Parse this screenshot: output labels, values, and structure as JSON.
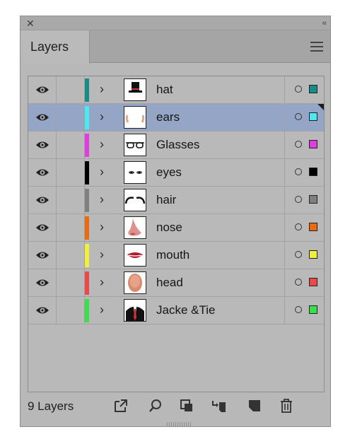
{
  "window": {
    "close_glyph": "✕",
    "collapse_glyph": "‹‹"
  },
  "tab": {
    "label": "Layers"
  },
  "layers": [
    {
      "name": "hat",
      "color": "#1a8a8a",
      "thumb": "hat-thumb"
    },
    {
      "name": "ears",
      "color": "#4ee8f0",
      "thumb": "ears-thumb",
      "selected": true
    },
    {
      "name": "Glasses",
      "color": "#e03ee0",
      "thumb": "glasses-thumb"
    },
    {
      "name": "eyes",
      "color": "#000000",
      "thumb": "eyes-thumb"
    },
    {
      "name": "hair",
      "color": "#808080",
      "thumb": "hair-thumb"
    },
    {
      "name": "nose",
      "color": "#ea6a10",
      "thumb": "nose-thumb"
    },
    {
      "name": "mouth",
      "color": "#f0f03a",
      "thumb": "mouth-thumb"
    },
    {
      "name": "head",
      "color": "#ec4848",
      "thumb": "head-thumb"
    },
    {
      "name": "Jacke &Tie",
      "color": "#38e04a",
      "thumb": "jacket-thumb"
    }
  ],
  "footer": {
    "count_label": "9 Layers",
    "tools": [
      "export-icon",
      "search-icon",
      "clipping-mask-icon",
      "move-to-layer-icon",
      "new-layer-icon",
      "trash-icon"
    ]
  }
}
